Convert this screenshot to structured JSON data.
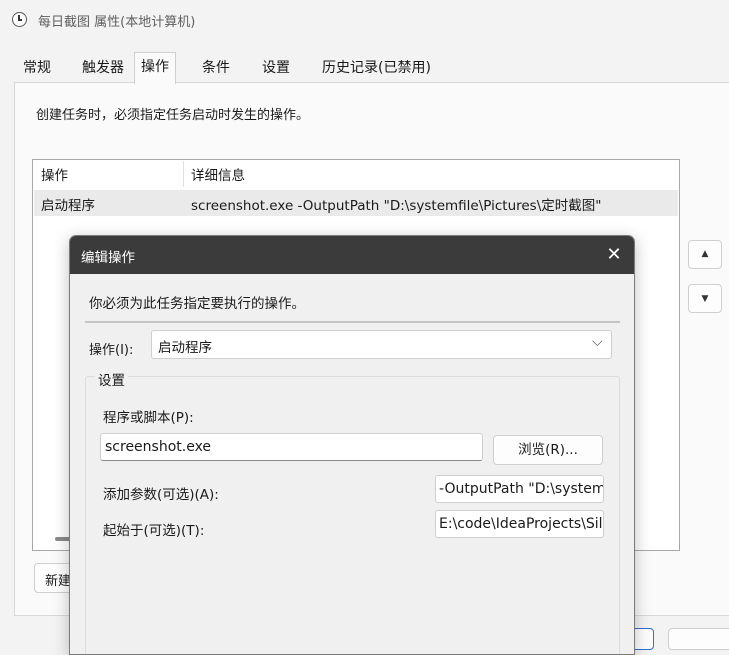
{
  "window": {
    "title": "每日截图 属性(本地计算机)",
    "icon": "clock-icon"
  },
  "tabs": [
    {
      "label": "常规"
    },
    {
      "label": "触发器"
    },
    {
      "label": "操作",
      "selected": true
    },
    {
      "label": "条件"
    },
    {
      "label": "设置"
    },
    {
      "label": "历史记录(已禁用)"
    }
  ],
  "actions_tab": {
    "description": "创建任务时，必须指定任务启动时发生的操作。",
    "columns": [
      "操作",
      "详细信息"
    ],
    "rows": [
      {
        "action": "启动程序",
        "details": "screenshot.exe -OutputPath \"D:\\systemfile\\Pictures\\定时截图\""
      }
    ],
    "move_up_icon": "triangle-up-icon",
    "move_down_icon": "triangle-down-icon",
    "new_button": "新建"
  },
  "edit_dialog": {
    "title": "编辑操作",
    "close_icon": "close-icon",
    "instruction": "你必须为此任务指定要执行的操作。",
    "action_label": "操作(I):",
    "action_value": "启动程序",
    "settings_group": "设置",
    "program_label": "程序或脚本(P):",
    "program_value": "screenshot.exe",
    "browse_button": "浏览(R)...",
    "args_label": "添加参数(可选)(A):",
    "args_value": "-OutputPath \"D:\\system",
    "start_label": "起始于(可选)(T):",
    "start_value": "E:\\code\\IdeaProjects\\Sil"
  }
}
